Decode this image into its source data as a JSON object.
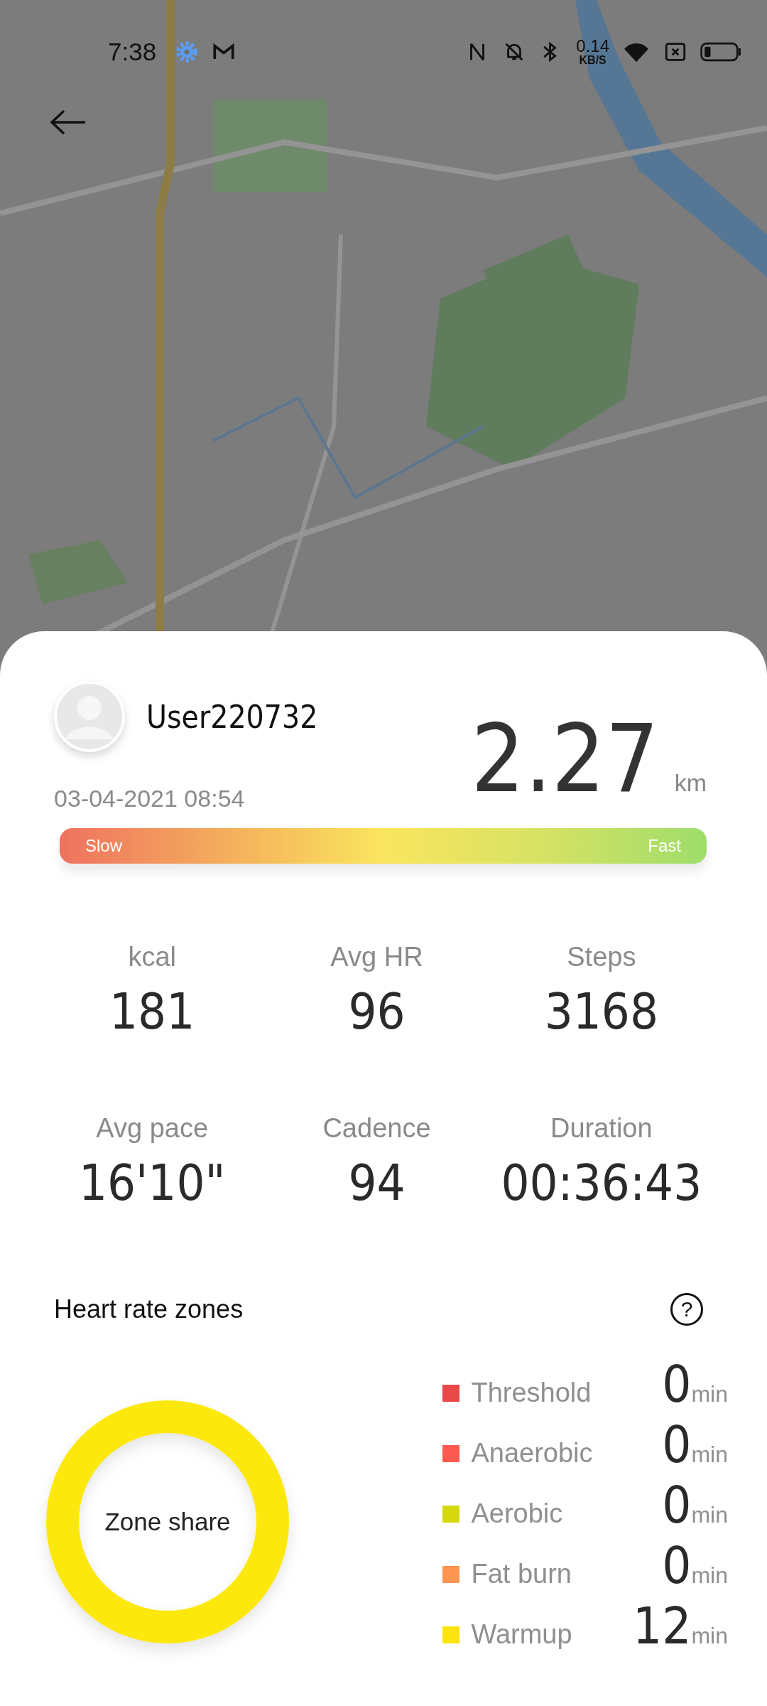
{
  "status_bar": {
    "time": "7:38",
    "net_speed": "0.14",
    "net_unit": "KB/S"
  },
  "workout": {
    "user": "User220732",
    "datetime": "03-04-2021 08:54",
    "distance": "2.27",
    "distance_unit": "km",
    "pace_bar": {
      "slow_label": "Slow",
      "fast_label": "Fast"
    }
  },
  "stats": [
    {
      "label": "kcal",
      "value": "181"
    },
    {
      "label": "Avg HR",
      "value": "96"
    },
    {
      "label": "Steps",
      "value": "3168"
    },
    {
      "label": "Avg pace",
      "value": "16'10\""
    },
    {
      "label": "Cadence",
      "value": "94"
    },
    {
      "label": "Duration",
      "value": "00:36:43"
    }
  ],
  "heart_rate_zones": {
    "title": "Heart rate zones",
    "help": "?",
    "ring_label": "Zone share",
    "zones": [
      {
        "name": "Threshold",
        "color": "#e84848",
        "value": "0",
        "unit": "min"
      },
      {
        "name": "Anaerobic",
        "color": "#fc5a50",
        "value": "0",
        "unit": "min"
      },
      {
        "name": "Aerobic",
        "color": "#d4d80c",
        "value": "0",
        "unit": "min"
      },
      {
        "name": "Fat burn",
        "color": "#fc9650",
        "value": "0",
        "unit": "min"
      },
      {
        "name": "Warmup",
        "color": "#fce30c",
        "value": "12",
        "unit": "min"
      }
    ]
  }
}
